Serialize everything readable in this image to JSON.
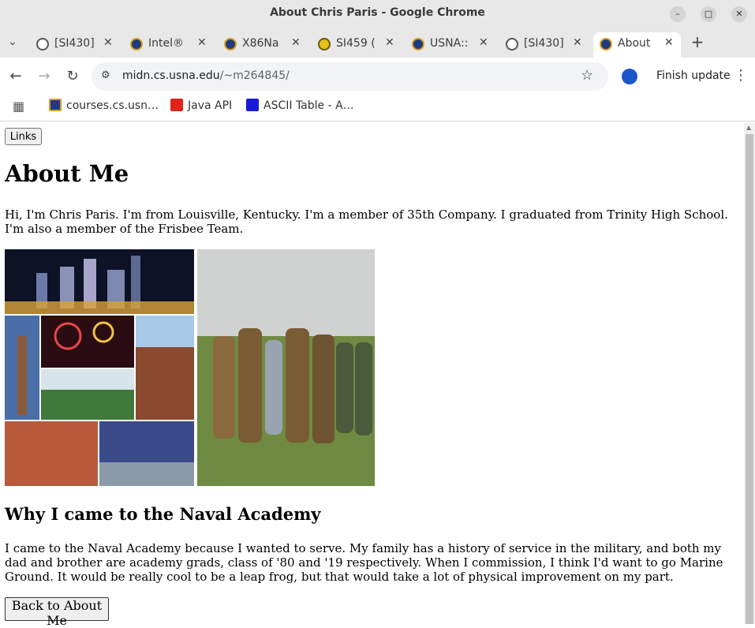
{
  "window": {
    "title": "About Chris Paris - Google Chrome"
  },
  "tabs": [
    {
      "label": "[SI430]",
      "icon": "globe-icon"
    },
    {
      "label": "Intel®",
      "icon": "usna-crest-icon"
    },
    {
      "label": "X86Na",
      "icon": "usna-crest-icon"
    },
    {
      "label": "SI459 (",
      "icon": "smiley-icon"
    },
    {
      "label": "USNA::",
      "icon": "usna-crest-icon"
    },
    {
      "label": "[SI430]",
      "icon": "globe-icon"
    },
    {
      "label": "About",
      "icon": "usna-crest-icon",
      "active": true
    }
  ],
  "toolbar": {
    "url_host": "midn.cs.usna.edu",
    "url_path": "/~m264845/",
    "finish_update": "Finish update"
  },
  "bookmarks": [
    {
      "label": "courses.cs.usn…",
      "icon": "usna-crest-icon"
    },
    {
      "label": "Java API",
      "icon": "oracle-icon"
    },
    {
      "label": "ASCII Table - A…",
      "icon": "at-sign-icon"
    }
  ],
  "page": {
    "links_button": "Links",
    "heading": "About Me",
    "intro": "Hi, I'm Chris Paris. I'm from Louisville, Kentucky. I'm a member of 35th Company. I graduated from Trinity High School. I'm also a member of the Frisbee Team.",
    "subheading": "Why I came to the Naval Academy",
    "reason": "I came to the Naval Academy because I wanted to serve. My family has a history of service in the military, and both my dad and brother are academy grads, class of '80 and '19 respectively. When I commission, I think I'd want to go Marine Ground. It would be really cool to be a leap frog, but that would take a lot of physical improvement on my part.",
    "back_button": "Back to About Me"
  },
  "colors": {
    "chrome_bg": "#e8e8e8",
    "omnibox_bg": "#f1f3f4",
    "active_tab": "#ffffff"
  }
}
